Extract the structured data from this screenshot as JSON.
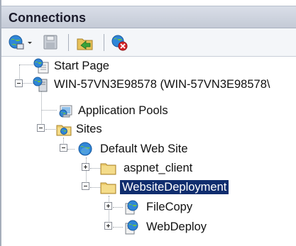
{
  "pane": {
    "title": "Connections"
  },
  "toolbar": {
    "buttons": [
      {
        "icon": "globe-connect-icon",
        "name": "create-connection-button"
      },
      {
        "icon": "dropdown-arrow-icon",
        "name": "connection-dropdown-button"
      },
      {
        "icon": "save-icon",
        "name": "save-connections-button"
      },
      {
        "icon": "up-folder-icon",
        "name": "up-one-level-button"
      },
      {
        "icon": "delete-connection-icon",
        "name": "delete-connection-button"
      }
    ]
  },
  "tree": {
    "nodes": [
      {
        "label": "Start Page",
        "icon": "start-page-icon",
        "level": 1,
        "expander": "none"
      },
      {
        "label": "WIN-57VN3E98578 (WIN-57VN3E98578\\",
        "icon": "server-icon",
        "level": 1,
        "expander": "minus"
      },
      {
        "label": "Application Pools",
        "icon": "application-pools-icon",
        "level": 2,
        "expander": "none"
      },
      {
        "label": "Sites",
        "icon": "sites-folder-icon",
        "level": 2,
        "expander": "minus"
      },
      {
        "label": "Default Web Site",
        "icon": "website-globe-icon",
        "level": 3,
        "expander": "minus"
      },
      {
        "label": "aspnet_client",
        "icon": "folder-icon",
        "level": 4,
        "expander": "plus"
      },
      {
        "label": "WebsiteDeployment",
        "icon": "folder-icon",
        "level": 4,
        "expander": "minus",
        "selected": true
      },
      {
        "label": "FileCopy",
        "icon": "web-application-icon",
        "level": 5,
        "expander": "plus"
      },
      {
        "label": "WebDeploy",
        "icon": "web-application-icon",
        "level": 5,
        "expander": "plus"
      }
    ]
  }
}
